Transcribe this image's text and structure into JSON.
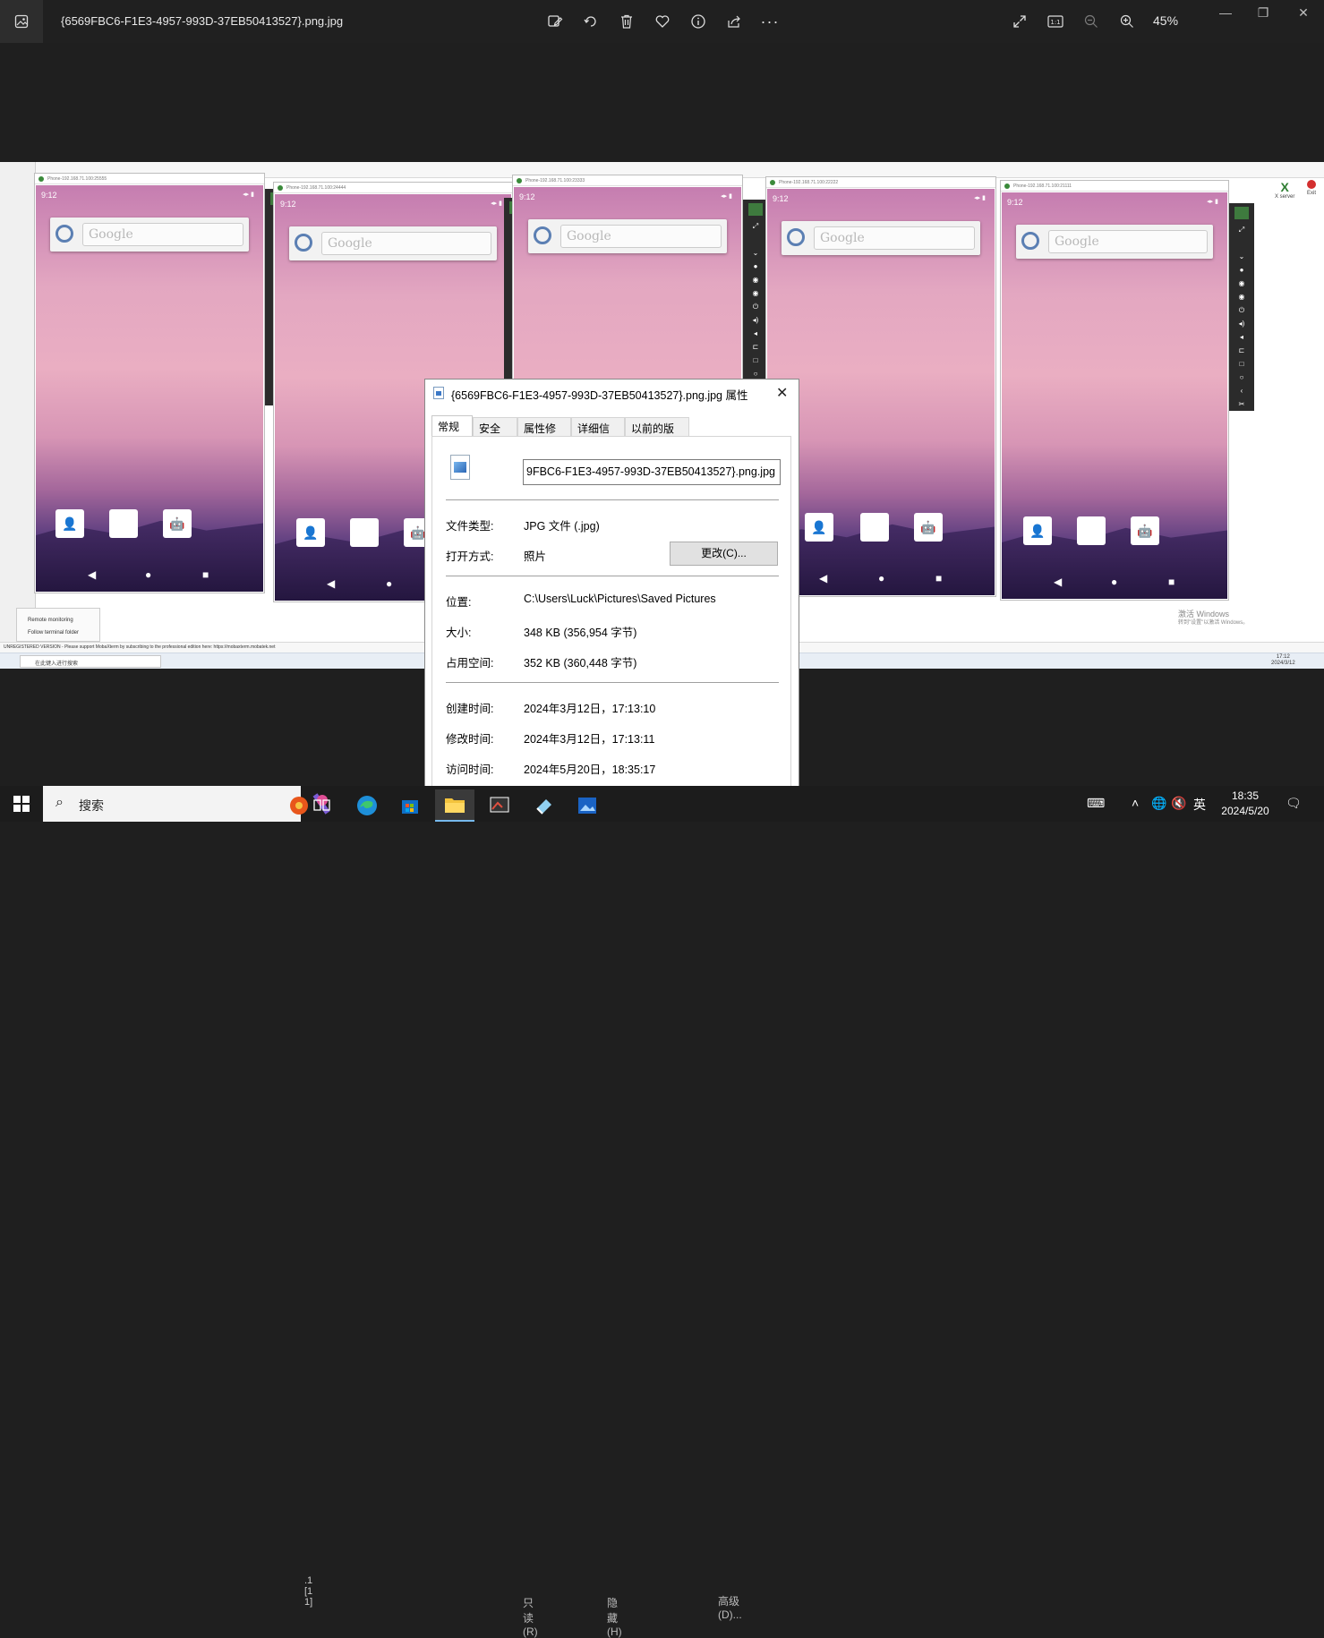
{
  "viewer": {
    "title": "{6569FBC6-F1E3-4957-993D-37EB50413527}.png.jpg",
    "zoom": "45%",
    "toolbar": {
      "edit_icon": "edit-image-icon",
      "rotate_icon": "rotate-icon",
      "delete_icon": "delete-icon",
      "favorite_icon": "heart-icon",
      "info_icon": "info-icon",
      "share_icon": "share-icon",
      "more_icon": "more-icon",
      "fullscreen_icon": "expand-icon",
      "actual_size_label": "1:1",
      "zoom_out_icon": "zoom-out-icon",
      "zoom_in_icon": "zoom-in-icon"
    }
  },
  "screenshot": {
    "moba_bottom_text": "UNREGISTERED VERSION  -  Please support MobaXterm by subscribing to the professional edition here:  https://mobaxterm.mobatek.net",
    "remote_monitoring": "Remote monitoring",
    "follow_terminal": "Follow terminal folder",
    "inner_search": "在此键入进行搜索",
    "inner_clock_time": "17:12",
    "inner_clock_date": "2024/3/12",
    "activate_title": "激活 Windows",
    "activate_sub": "转到\"设置\"以激活 Windows。",
    "xserver_label": "X server",
    "exit_label": "Exit",
    "phones": [
      {
        "title": "Phone-192.168.71.100:25555",
        "time": "9:12"
      },
      {
        "title": "Phone-192.168.71.100:24444",
        "time": "9:12"
      },
      {
        "title": "Phone-192.168.71.100:23333",
        "time": "9:12"
      },
      {
        "title": "Phone-192.168.71.100:22222",
        "time": "9:12"
      },
      {
        "title": "Phone-192.168.71.100:21111",
        "time": "9:12"
      }
    ],
    "search_placeholder": "Google"
  },
  "dialog": {
    "title": "{6569FBC6-F1E3-4957-993D-37EB50413527}.png.jpg 属性",
    "tabs": [
      "常规",
      "安全",
      "属性修改",
      "详细信息",
      "以前的版本"
    ],
    "filename": "9FBC6-F1E3-4957-993D-37EB50413527}.png.jpg",
    "file_type_label": "文件类型:",
    "file_type_value": "JPG 文件 (.jpg)",
    "open_with_label": "打开方式:",
    "open_with_value": "照片",
    "change_button": "更改(C)...",
    "location_label": "位置:",
    "location_value": "C:\\Users\\Luck\\Pictures\\Saved Pictures",
    "size_label": "大小:",
    "size_value": "348 KB (356,954 字节)",
    "disk_size_label": "占用空间:",
    "disk_size_value": "352 KB (360,448 字节)",
    "created_label": "创建时间:",
    "created_value": "2024年3月12日，17:13:10",
    "modified_label": "修改时间:",
    "modified_value": "2024年3月12日，17:13:11",
    "accessed_label": "访问时间:",
    "accessed_value": "2024年5月20日，18:35:17"
  },
  "taskbar": {
    "search_label": "搜索",
    "language": "英",
    "time": "18:35",
    "date": "2024/5/20",
    "ghost_text": ".1 [1 1]",
    "ghost_readonly": "只读(R)",
    "ghost_hidden": "隐藏(H)",
    "ghost_advanced": "高级(D)..."
  }
}
